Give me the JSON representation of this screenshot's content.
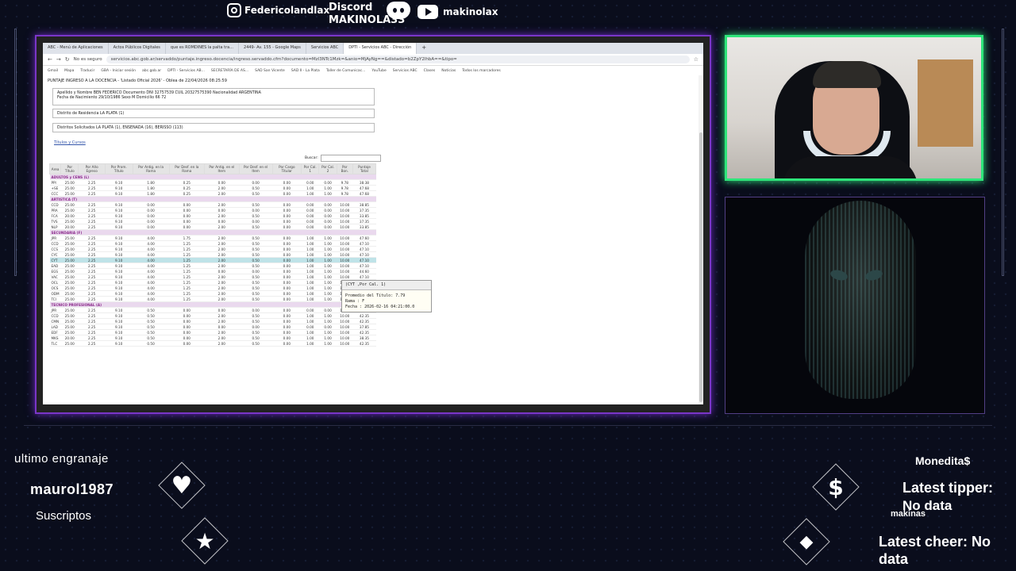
{
  "header": {
    "instagram_handle": "Federicolandlax",
    "discord_label": "Discord",
    "discord_server": "MAKINOLA33",
    "youtube_handle": "makinolax"
  },
  "browser": {
    "tabs": [
      {
        "label": "ABC - Menú de Aplicaciones",
        "active": false
      },
      {
        "label": "Actos Públicos Digitales",
        "active": false
      },
      {
        "label": "que es ROMDINES la palta tra...",
        "active": false
      },
      {
        "label": "2449- Av. 155 - Google Maps",
        "active": false
      },
      {
        "label": "Servicios ABC",
        "active": false
      },
      {
        "label": "DPTI - Servicios ABC - Dirección",
        "active": true
      }
    ],
    "security_label": "No es seguro",
    "url": "servicios.abc.gob.ar/servaddo/puntaje.ingreso.docencia/ingreso.servaddo.cfm?documento=Mzl3NTc1Mzk=&anio=MjAyNg==&distado=b2ZpY2lhbA==&tipo=",
    "bookmarks": [
      "Gmail",
      "Mapa",
      "Traducir",
      "GBA - Iniciar sesión",
      "abc.gob.ar",
      "DPTI - Servicios AB...",
      "SECRETARÍA DE AS...",
      "SAD San Vicente",
      "SAD II - La Plata",
      "Taller de Comunicac...",
      "YouTube",
      "Servicios ABC",
      "Clases",
      "Noticias",
      "Todos los marcadores"
    ]
  },
  "page": {
    "title": "PUNTAJE INGRESO A LA DOCENCIA - 'Listado Oficial 2026' - Oblea de 22/04/2026 08:25:59",
    "person_line1": "Apellido y Nombre BEN FEDERICO  Documento DNI  32757539  CUIL 20327575390  Nacionalidad ARGENTINA",
    "person_line2": "Fecha de Nacimiento 29/10/1986  Sexo M  Domicilio 66 72",
    "district": "Distrito de Residencia LA PLATA (1)",
    "requested": "Distritos Solicitados LA PLATA (1), ENSENADA (16), BERISSO (113)",
    "link": "Títulos y Cursos",
    "search_label": "Buscar:",
    "columns": [
      "Area",
      "Por Título",
      "Por Año Egreso",
      "Por Prom. Título",
      "Por Antig. en la Rama",
      "Por Desf. en la Rama",
      "Por Antig. en el Item",
      "Por Desf. en el Item",
      "Por Cargo Titular",
      "Por Cal. 1",
      "Por Cal. 2",
      "Por Bon.",
      "Puntaje Total"
    ],
    "sections": [
      {
        "name": "ADULTOS y CENS (L)",
        "rows": [
          [
            "PPI",
            "25.00",
            "2.25",
            "9.10",
            "1.80",
            "0.25",
            "0.00",
            "0.00",
            "0.00",
            "0.00",
            "0.00",
            "9.78",
            "38.38"
          ],
          [
            "+SE",
            "25.00",
            "2.25",
            "9.10",
            "1.80",
            "0.25",
            "2.00",
            "0.50",
            "0.00",
            "1.00",
            "1.00",
            "9.78",
            "47.68"
          ],
          [
            "CCC",
            "25.00",
            "2.25",
            "9.10",
            "1.80",
            "0.25",
            "2.00",
            "0.50",
            "0.00",
            "1.00",
            "1.00",
            "9.78",
            "47.68"
          ]
        ]
      },
      {
        "name": "ARTISTICA (T)",
        "rows": [
          [
            "CCD",
            "25.00",
            "2.25",
            "9.10",
            "0.00",
            "0.00",
            "2.00",
            "0.50",
            "0.00",
            "0.00",
            "0.00",
            "10.00",
            "38.85"
          ],
          [
            "PRA",
            "25.00",
            "2.25",
            "9.10",
            "0.00",
            "0.00",
            "0.00",
            "0.00",
            "0.00",
            "0.00",
            "0.00",
            "10.00",
            "37.35"
          ],
          [
            "FCA",
            "20.00",
            "2.25",
            "9.10",
            "0.00",
            "0.00",
            "2.00",
            "0.50",
            "0.00",
            "0.00",
            "0.00",
            "10.00",
            "33.85"
          ],
          [
            "TVS",
            "25.00",
            "2.25",
            "9.10",
            "0.00",
            "0.00",
            "0.00",
            "0.00",
            "0.00",
            "0.00",
            "0.00",
            "10.00",
            "37.35"
          ],
          [
            "NLP",
            "20.00",
            "2.25",
            "9.10",
            "0.00",
            "0.00",
            "2.00",
            "0.50",
            "0.00",
            "0.00",
            "0.00",
            "10.00",
            "33.85"
          ]
        ]
      },
      {
        "name": "SECUNDARIA (F)",
        "rows": [
          [
            "JPR",
            "25.00",
            "2.25",
            "9.10",
            "4.00",
            "1.75",
            "2.00",
            "0.50",
            "0.00",
            "1.00",
            "1.00",
            "10.00",
            "47.60"
          ],
          [
            "CCD",
            "25.00",
            "2.25",
            "9.10",
            "4.00",
            "1.25",
            "2.00",
            "0.50",
            "0.00",
            "1.00",
            "1.00",
            "10.00",
            "47.10"
          ],
          [
            "CCS",
            "25.00",
            "2.25",
            "9.10",
            "4.00",
            "1.25",
            "2.00",
            "0.50",
            "0.00",
            "1.00",
            "1.00",
            "10.00",
            "47.10"
          ],
          [
            "CYC",
            "25.00",
            "2.25",
            "9.10",
            "4.00",
            "1.25",
            "2.00",
            "0.50",
            "0.00",
            "1.00",
            "1.00",
            "10.00",
            "47.10"
          ],
          [
            "CYT",
            "25.00",
            "2.25",
            "9.10",
            "4.00",
            "1.25",
            "2.00",
            "0.50",
            "0.00",
            "1.00",
            "1.00",
            "10.00",
            "47.10"
          ],
          [
            "EAD",
            "25.00",
            "2.25",
            "9.10",
            "4.00",
            "1.25",
            "2.00",
            "0.50",
            "0.00",
            "1.00",
            "1.00",
            "10.00",
            "47.10"
          ],
          [
            "EGS",
            "25.00",
            "2.25",
            "9.10",
            "4.00",
            "1.25",
            "0.00",
            "0.00",
            "0.00",
            "1.00",
            "1.00",
            "10.00",
            "44.60"
          ],
          [
            "VAC",
            "25.00",
            "2.25",
            "9.10",
            "4.00",
            "1.25",
            "2.00",
            "0.50",
            "0.00",
            "1.00",
            "1.00",
            "10.00",
            "47.10"
          ],
          [
            "OCL",
            "25.00",
            "2.25",
            "9.10",
            "4.00",
            "1.25",
            "2.00",
            "0.50",
            "0.00",
            "1.00",
            "1.00",
            "10.00",
            "47.10"
          ],
          [
            "OCS",
            "25.00",
            "2.25",
            "9.10",
            "4.00",
            "1.25",
            "2.00",
            "0.50",
            "0.00",
            "1.00",
            "1.00",
            "10.00",
            "47.10"
          ],
          [
            "ODM",
            "25.00",
            "2.25",
            "9.10",
            "4.00",
            "1.25",
            "2.00",
            "0.50",
            "0.00",
            "1.00",
            "1.00",
            "10.00",
            "47.10"
          ],
          [
            "TCI",
            "25.00",
            "2.25",
            "9.10",
            "4.00",
            "1.25",
            "2.00",
            "0.50",
            "0.00",
            "1.00",
            "1.00",
            "10.00",
            "47.10"
          ]
        ]
      },
      {
        "name": "TECNICO PROFESIONAL (A)",
        "rows": [
          [
            "JPR",
            "25.00",
            "2.25",
            "9.10",
            "0.50",
            "0.00",
            "0.00",
            "0.00",
            "0.00",
            "0.00",
            "0.00",
            "10.00",
            "37.85"
          ],
          [
            "CCD",
            "25.00",
            "2.25",
            "9.10",
            "0.50",
            "0.00",
            "2.00",
            "0.50",
            "0.00",
            "1.00",
            "1.00",
            "10.00",
            "42.35"
          ],
          [
            "CMN",
            "25.00",
            "2.25",
            "9.10",
            "0.50",
            "0.00",
            "2.00",
            "0.50",
            "0.00",
            "1.00",
            "1.00",
            "10.00",
            "42.35"
          ],
          [
            "LAD",
            "25.00",
            "2.25",
            "9.10",
            "0.50",
            "0.00",
            "0.00",
            "0.00",
            "0.00",
            "0.00",
            "0.00",
            "10.00",
            "37.85"
          ],
          [
            "EDF",
            "25.00",
            "2.25",
            "9.10",
            "0.50",
            "0.00",
            "2.00",
            "0.50",
            "0.00",
            "1.00",
            "1.00",
            "10.00",
            "42.35"
          ],
          [
            "MKS",
            "20.00",
            "2.25",
            "9.10",
            "0.50",
            "0.00",
            "2.00",
            "0.50",
            "0.00",
            "1.00",
            "1.00",
            "10.00",
            "38.35"
          ],
          [
            "TLC",
            "25.00",
            "2.25",
            "9.10",
            "0.50",
            "0.00",
            "2.00",
            "0.50",
            "0.00",
            "1.00",
            "1.00",
            "10.00",
            "42.35"
          ]
        ]
      }
    ],
    "highlighted_row": "CYT",
    "tooltip": {
      "title": "(CYT ,Por Cal. 1)",
      "line1": "Promedio del Título: 7.79",
      "line2": "Rama : F",
      "line3": "Fecha : 2026-02-16 04:21:00.0"
    }
  },
  "overlay": {
    "last_gear_label": "ultimo engranaje",
    "last_gear_user": "maurol1987",
    "subs_label": "Suscriptos",
    "currency_label": "Monedita$",
    "tipper_label": "Latest tipper:",
    "tipper_value": "No data",
    "currency_name": "makinas",
    "cheer_label": "Latest cheer: No",
    "cheer_value": "data"
  },
  "colors": {
    "capture_border": "#7a36c8",
    "cam_border": "#2ee57a",
    "section_text": "#8a2a8a",
    "highlight_row": "#bfe3e8"
  }
}
